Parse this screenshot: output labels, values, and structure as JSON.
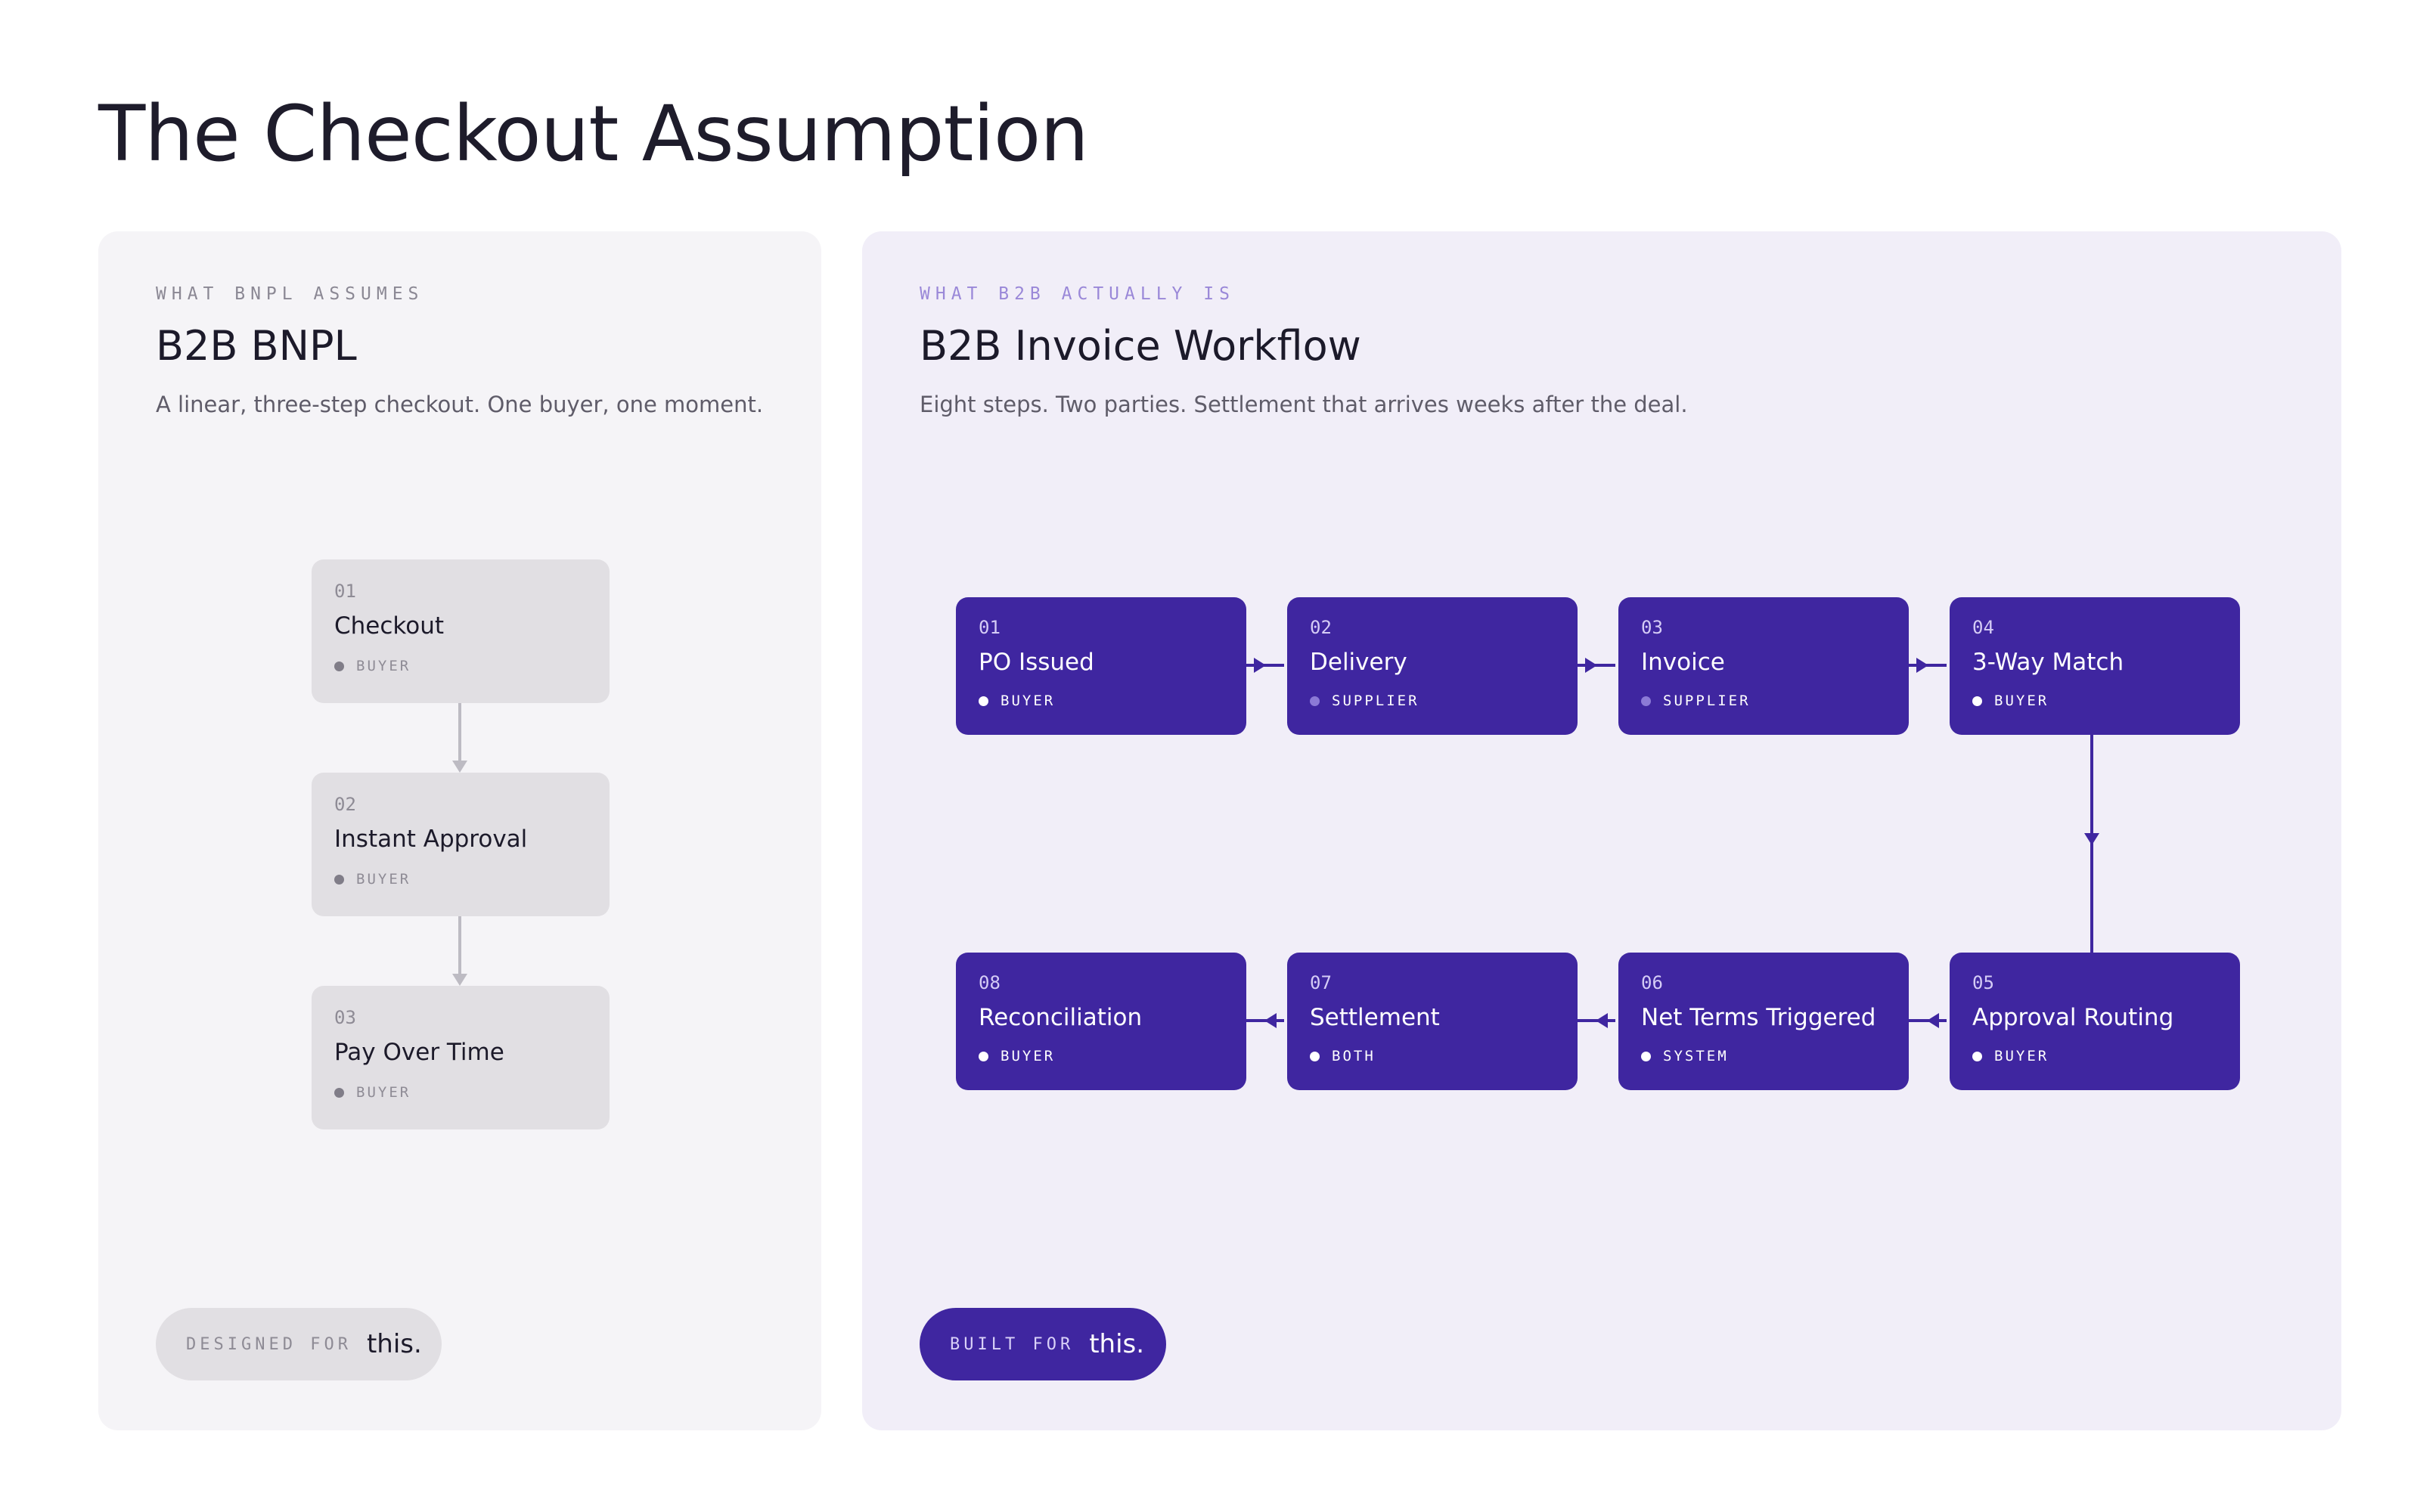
{
  "title": "The Checkout Assumption",
  "left_panel": {
    "eyebrow": "WHAT BNPL ASSUMES",
    "heading": "B2B BNPL",
    "description": "A linear, three-step checkout. One buyer, one moment.",
    "steps": [
      {
        "num": "01",
        "title": "Checkout",
        "role": "BUYER"
      },
      {
        "num": "02",
        "title": "Instant Approval",
        "role": "BUYER"
      },
      {
        "num": "03",
        "title": "Pay Over Time",
        "role": "BUYER"
      }
    ],
    "badge": {
      "small": "DESIGNED FOR",
      "big": "this."
    }
  },
  "right_panel": {
    "eyebrow": "WHAT B2B ACTUALLY IS",
    "heading": "B2B Invoice Workflow",
    "description": "Eight steps. Two parties. Settlement that arrives weeks after the deal.",
    "steps": [
      {
        "num": "01",
        "title": "PO Issued",
        "role": "BUYER"
      },
      {
        "num": "02",
        "title": "Delivery",
        "role": "SUPPLIER"
      },
      {
        "num": "03",
        "title": "Invoice",
        "role": "SUPPLIER"
      },
      {
        "num": "04",
        "title": "3-Way Match",
        "role": "BUYER"
      },
      {
        "num": "05",
        "title": "Approval Routing",
        "role": "BUYER"
      },
      {
        "num": "06",
        "title": "Net Terms Triggered",
        "role": "SYSTEM"
      },
      {
        "num": "07",
        "title": "Settlement",
        "role": "BOTH"
      },
      {
        "num": "08",
        "title": "Reconciliation",
        "role": "BUYER"
      }
    ],
    "badge": {
      "small": "BUILT FOR",
      "big": "this."
    }
  },
  "colors": {
    "accent": "#3f26a0",
    "gray_node": "#e1dfe3",
    "left_bg": "#f5f4f7",
    "right_bg": "#f1eef8"
  }
}
